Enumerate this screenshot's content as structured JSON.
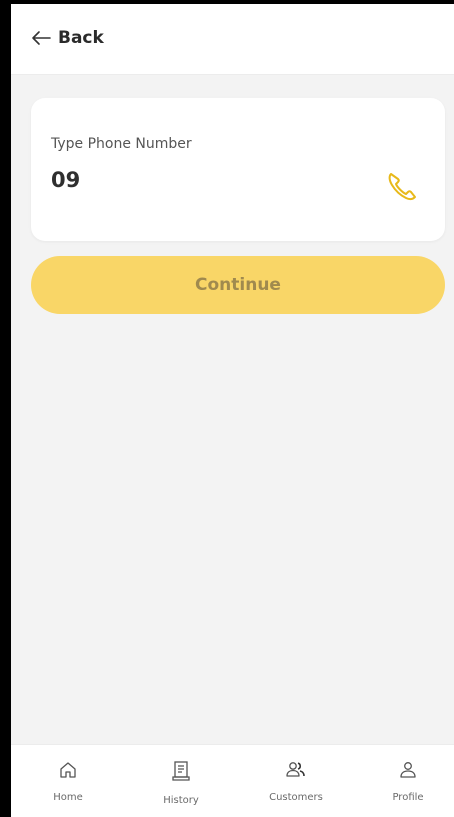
{
  "header": {
    "back_label": "Back",
    "back_icon": "arrow-left-icon"
  },
  "phone_card": {
    "label": "Type Phone Number",
    "value": "09",
    "icon": "phone-icon",
    "accent_color": "#e8b91a"
  },
  "continue_button": {
    "label": "Continue",
    "background": "#f9d667",
    "text_color": "#a08a4e"
  },
  "bottom_nav": {
    "items": [
      {
        "label": "Home",
        "icon": "home-icon"
      },
      {
        "label": "History",
        "icon": "receipt-icon"
      },
      {
        "label": "Customers",
        "icon": "users-icon"
      },
      {
        "label": "Profile",
        "icon": "user-icon"
      }
    ]
  }
}
